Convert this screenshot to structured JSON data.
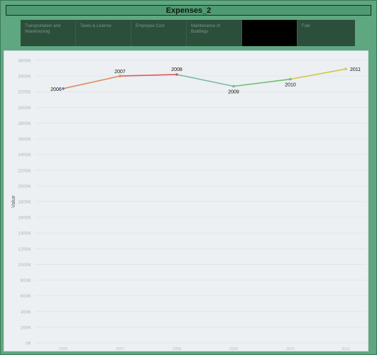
{
  "title": "Expenses_2",
  "filters": [
    {
      "label": "Transportation and Warehousing",
      "selected": false
    },
    {
      "label": "Taxes & License",
      "selected": false
    },
    {
      "label": "Employee Cost",
      "selected": false
    },
    {
      "label": "Maintenance of Buildings",
      "selected": false
    },
    {
      "label": "",
      "selected": true
    },
    {
      "label": "Fuel",
      "selected": false
    }
  ],
  "chart_data": {
    "type": "line",
    "ylabel": "Value",
    "xlabel": "",
    "x": [
      "2006",
      "2007",
      "2008",
      "2009",
      "2010",
      "2011"
    ],
    "values": [
      3240,
      3400,
      3420,
      3270,
      3360,
      3490
    ],
    "point_labels": [
      "2006",
      "2007",
      "2008",
      "2009",
      "2010",
      "2011"
    ],
    "ylim": [
      0,
      3600
    ],
    "yticks": [
      0,
      200,
      400,
      600,
      800,
      1000,
      1200,
      1400,
      1600,
      1800,
      2000,
      2200,
      2400,
      2600,
      2800,
      3000,
      3200,
      3400,
      3600
    ],
    "ytick_labels": [
      "0K",
      "200K",
      "400K",
      "600K",
      "800K",
      "1000K",
      "1200K",
      "1400K",
      "1600K",
      "1800K",
      "2000K",
      "2200K",
      "2400K",
      "2600K",
      "2800K",
      "3000K",
      "3200K",
      "3400K",
      "3600K"
    ],
    "grid": true,
    "line_colors": [
      "#5b7fb8",
      "#e08a5c",
      "#e05a5a",
      "#79b8a8",
      "#6fbf6f",
      "#d6c64a"
    ]
  }
}
